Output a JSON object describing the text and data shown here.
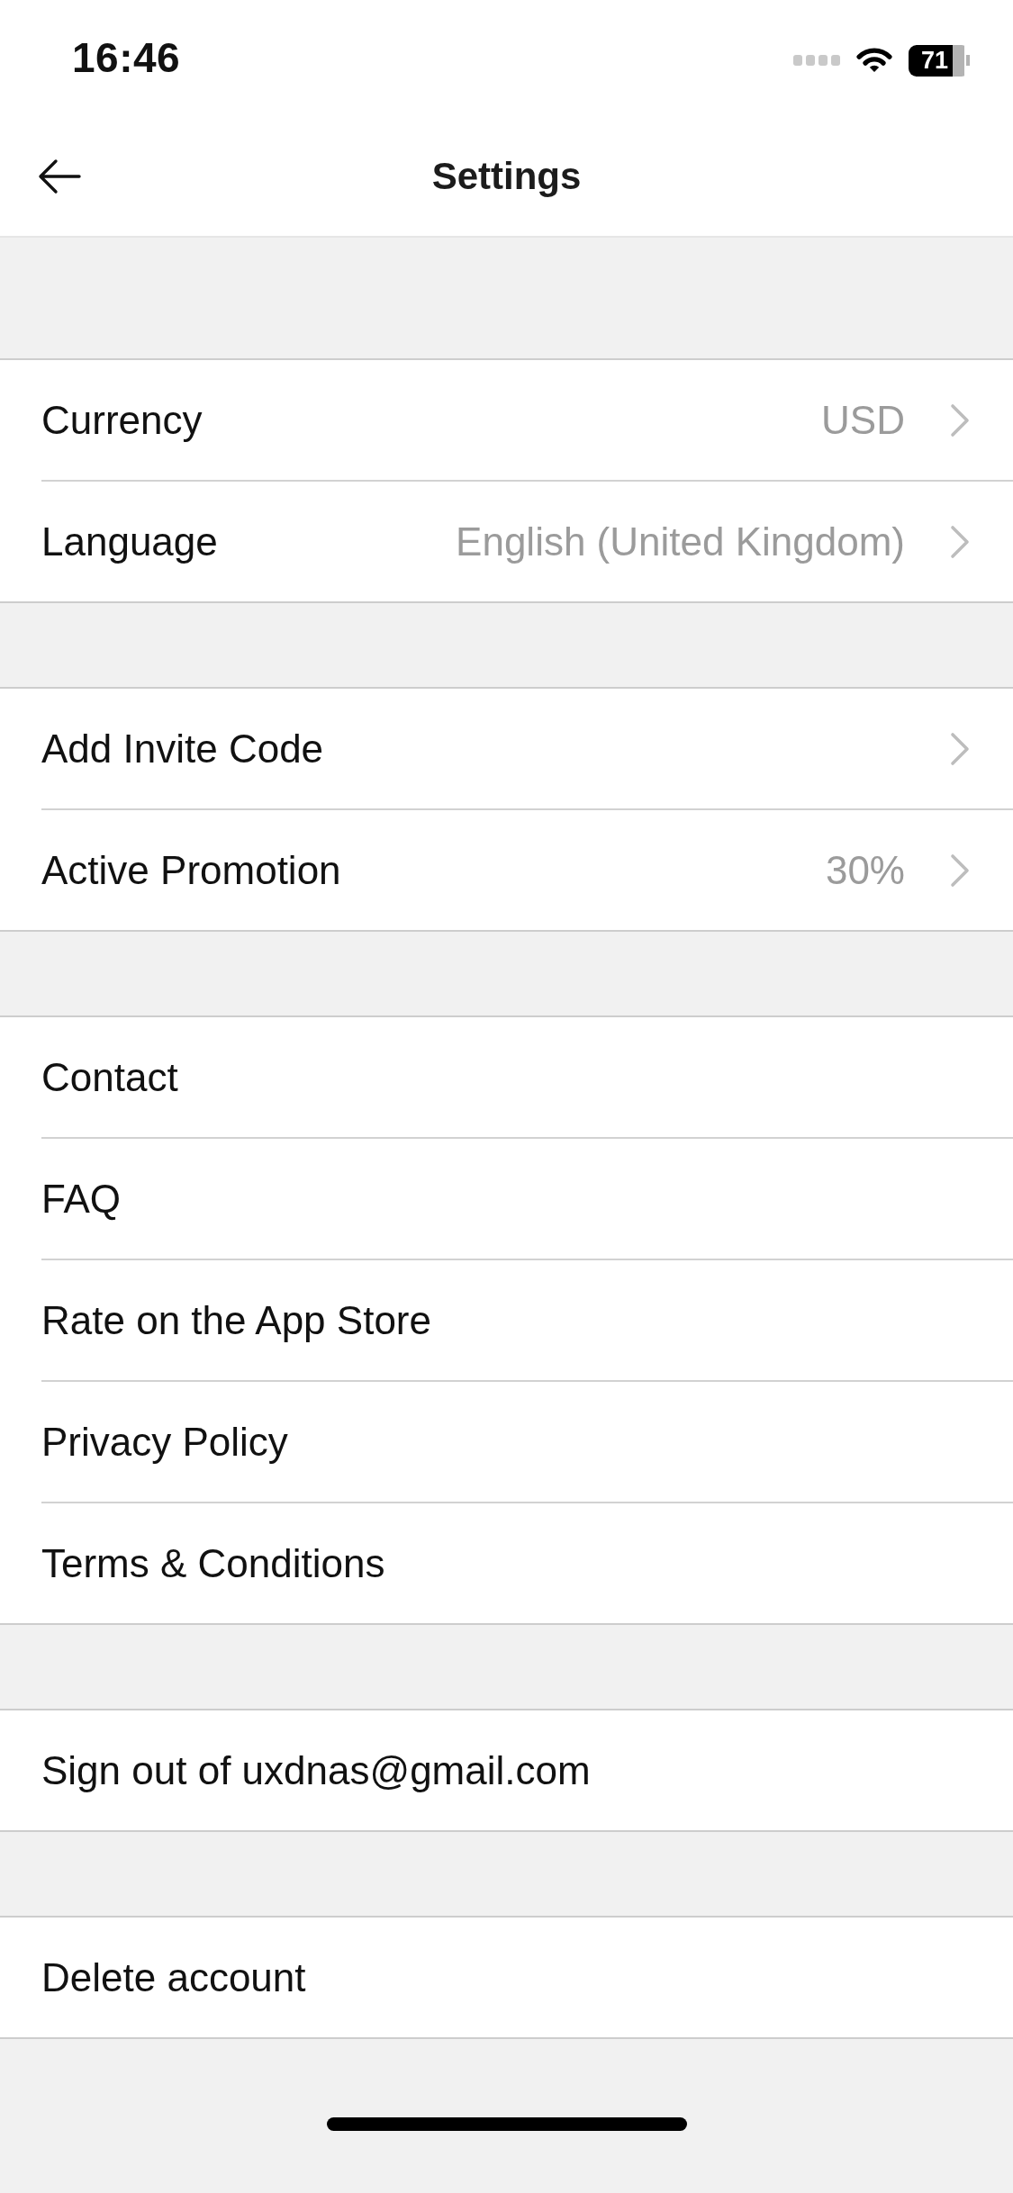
{
  "status_bar": {
    "time": "16:46",
    "battery": "71"
  },
  "header": {
    "title": "Settings"
  },
  "sections": [
    {
      "items": [
        {
          "kind": "link",
          "label": "Currency",
          "value": "USD"
        },
        {
          "kind": "link",
          "label": "Language",
          "value": "English (United Kingdom)"
        }
      ]
    },
    {
      "items": [
        {
          "kind": "link",
          "label": "Add Invite Code"
        },
        {
          "kind": "link",
          "label": "Active Promotion",
          "value": "30%"
        }
      ]
    },
    {
      "items": [
        {
          "kind": "plain",
          "label": "Contact"
        },
        {
          "kind": "plain",
          "label": "FAQ"
        },
        {
          "kind": "plain",
          "label": "Rate on the App Store"
        },
        {
          "kind": "plain",
          "label": "Privacy Policy"
        },
        {
          "kind": "plain",
          "label": "Terms & Conditions"
        }
      ]
    },
    {
      "items": [
        {
          "kind": "plain",
          "label": "Sign out of uxdnas@gmail.com"
        }
      ]
    },
    {
      "items": [
        {
          "kind": "plain",
          "label": "Delete account"
        }
      ]
    }
  ]
}
